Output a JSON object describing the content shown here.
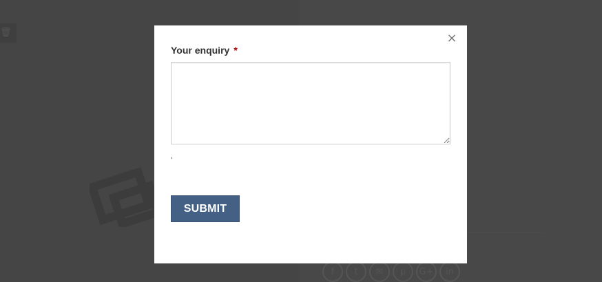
{
  "modal": {
    "close_glyph": "×",
    "field_label": "Your enquiry",
    "required_mark": "*",
    "enquiry_value": "",
    "stray_mark": "'",
    "submit_label": "SUBMIT"
  },
  "background": {
    "trash_glyph": "🗑",
    "share_icons": [
      "f",
      "t",
      "✉",
      "p",
      "G+",
      "in"
    ]
  },
  "colors": {
    "overlay": "#454545",
    "submit": "#446084",
    "required": "#b20000"
  }
}
